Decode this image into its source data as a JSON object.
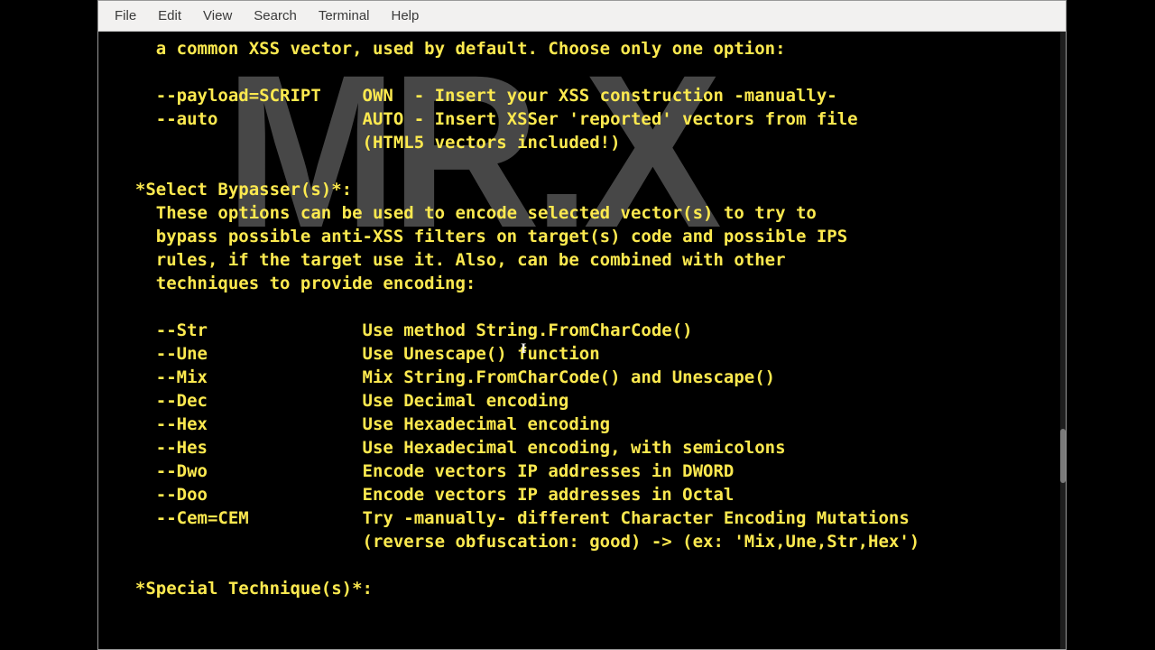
{
  "menubar": {
    "file": "File",
    "edit": "Edit",
    "view": "View",
    "search": "Search",
    "terminal": "Terminal",
    "help": "Help"
  },
  "watermark": "MR.X",
  "terminal": {
    "line01": "    a common XSS vector, used by default. Choose only one option:",
    "line02": "",
    "line03": "    --payload=SCRIPT    OWN  - Insert your XSS construction -manually-",
    "line04": "    --auto              AUTO - Insert XSSer 'reported' vectors from file",
    "line05": "                        (HTML5 vectors included!)",
    "line06": "",
    "line07": "  *Select Bypasser(s)*:",
    "line08": "    These options can be used to encode selected vector(s) to try to",
    "line09": "    bypass possible anti-XSS filters on target(s) code and possible IPS",
    "line10": "    rules, if the target use it. Also, can be combined with other",
    "line11": "    techniques to provide encoding:",
    "line12": "",
    "line13": "    --Str               Use method String.FromCharCode()",
    "line14": "    --Une               Use Unescape() function",
    "line15": "    --Mix               Mix String.FromCharCode() and Unescape()",
    "line16": "    --Dec               Use Decimal encoding",
    "line17": "    --Hex               Use Hexadecimal encoding",
    "line18": "    --Hes               Use Hexadecimal encoding, with semicolons",
    "line19": "    --Dwo               Encode vectors IP addresses in DWORD",
    "line20": "    --Doo               Encode vectors IP addresses in Octal",
    "line21": "    --Cem=CEM           Try -manually- different Character Encoding Mutations",
    "line22": "                        (reverse obfuscation: good) -> (ex: 'Mix,Une,Str,Hex')",
    "line23": "",
    "line24": "  *Special Technique(s)*:"
  }
}
